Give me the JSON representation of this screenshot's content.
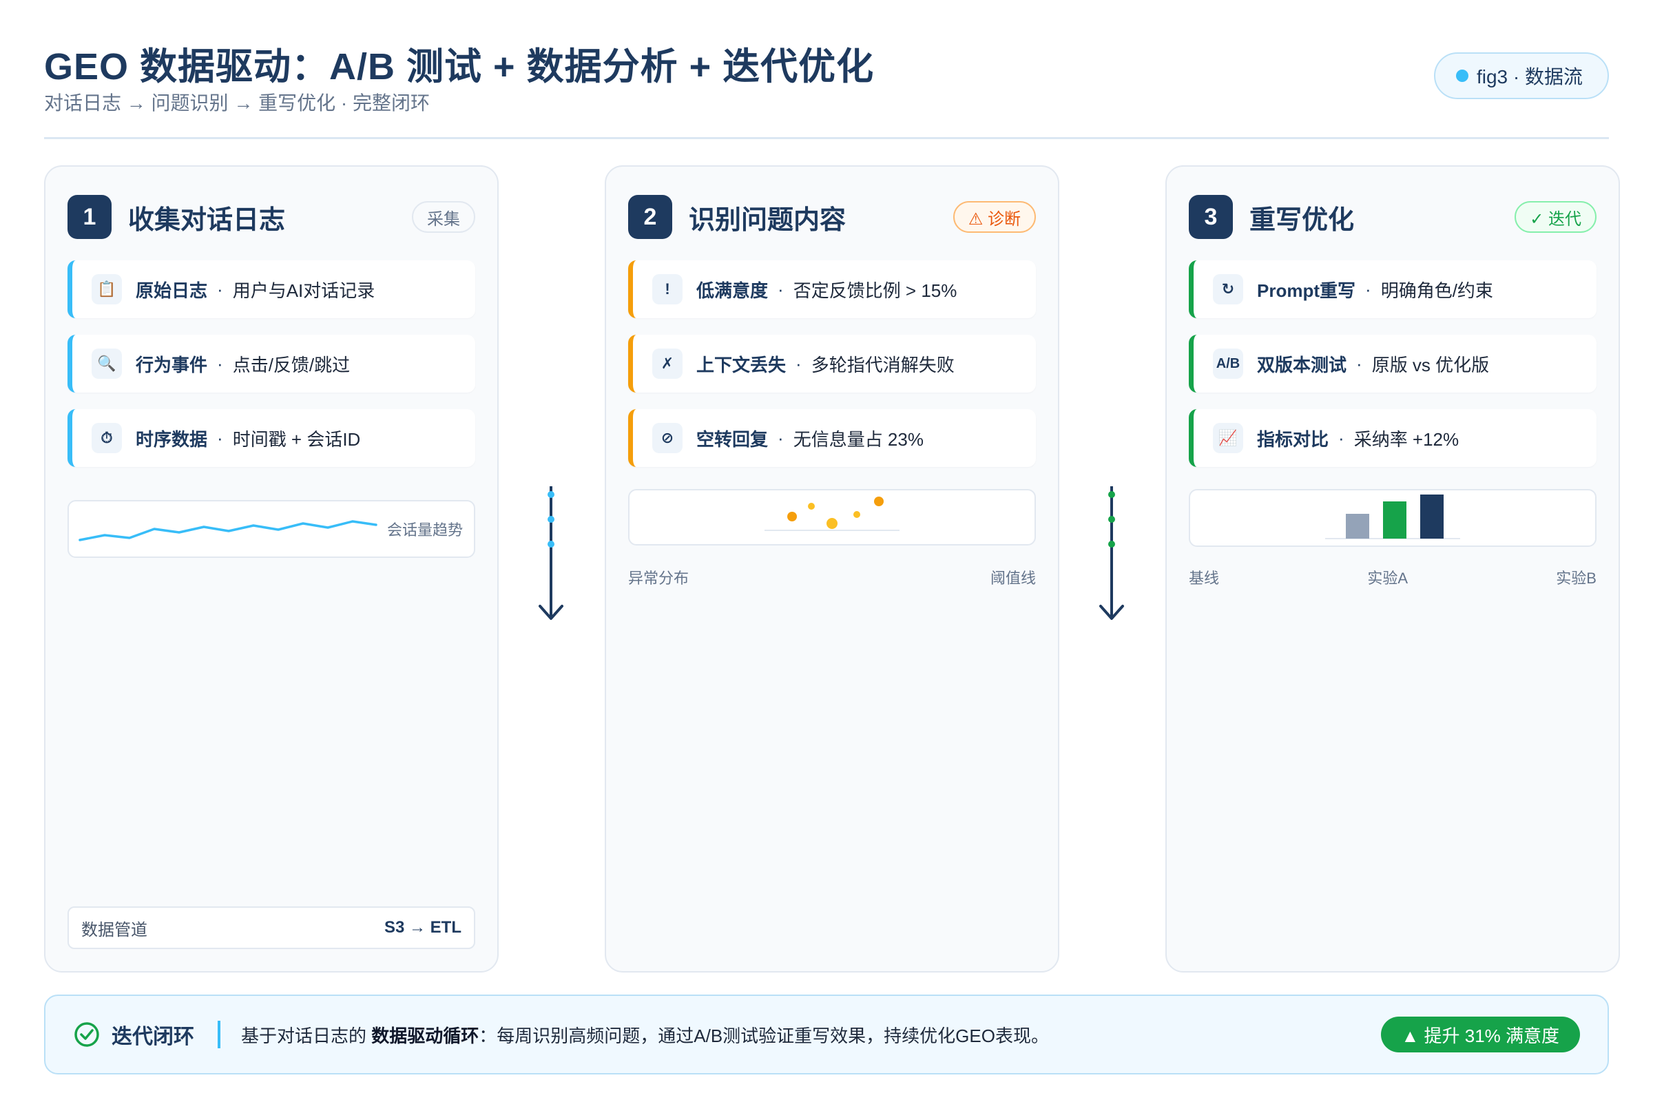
{
  "header": {
    "title": "GEO 数据驱动：A/B 测试 + 数据分析 + 迭代优化",
    "subtitle": "对话日志 → 问题识别 → 重写优化 · 完整闭环",
    "tag": "fig3 · 数据流"
  },
  "panels": [
    {
      "num": "1",
      "title": "收集对话日志",
      "badge": "采集",
      "items": [
        {
          "icon": "📋",
          "name": "原始日志",
          "desc": "用户与AI对话记录"
        },
        {
          "icon": "🔍",
          "name": "行为事件",
          "desc": "点击/反馈/跳过"
        },
        {
          "icon": "⏱",
          "name": "时序数据",
          "desc": "时间戳 + 会话ID"
        }
      ],
      "chart_caption": "会话量趋势",
      "footer_left": "数据管道",
      "footer_right": "S3 → ETL"
    },
    {
      "num": "2",
      "title": "识别问题内容",
      "badge": "⚠ 诊断",
      "items": [
        {
          "icon": "!",
          "name": "低满意度",
          "desc": "否定反馈比例 > 15%"
        },
        {
          "icon": "✗",
          "name": "上下文丢失",
          "desc": "多轮指代消解失败"
        },
        {
          "icon": "⊘",
          "name": "空转回复",
          "desc": "无信息量占 23%"
        }
      ],
      "caption_left": "异常分布",
      "caption_right": "阈值线"
    },
    {
      "num": "3",
      "title": "重写优化",
      "badge": "✓ 迭代",
      "items": [
        {
          "icon": "↻",
          "name": "Prompt重写",
          "desc": "明确角色/约束"
        },
        {
          "icon": "A/B",
          "name": "双版本测试",
          "desc": "原版 vs 优化版"
        },
        {
          "icon": "📈",
          "name": "指标对比",
          "desc": "采纳率 +12%"
        }
      ],
      "caption_left": "基线",
      "caption_mid": "实验A",
      "caption_right": "实验B"
    }
  ],
  "bottom": {
    "title": "迭代闭环",
    "text_pre": "基于对话日志的 ",
    "text_bold": "数据驱动循环",
    "text_post": "：每周识别高频问题，通过A/B测试验证重写效果，持续优化GEO表现。",
    "pill": "▲ 提升 31% 满意度"
  },
  "colors": {
    "navy": "#1e3a5f",
    "blue": "#38bdf8",
    "orange": "#f59e0b",
    "green": "#16a34a",
    "gray": "#94a3b8"
  },
  "icons": {
    "arrow_1_2": "arrow-down-icon",
    "arrow_2_3": "arrow-down-icon",
    "bottom": "check-circle-icon"
  }
}
